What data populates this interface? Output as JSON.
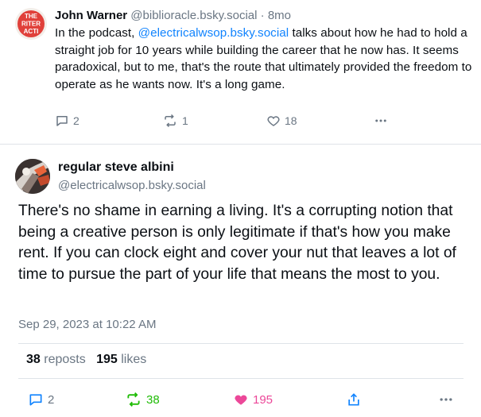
{
  "reply_post": {
    "author_name": "John Warner",
    "author_handle": "@biblioracle.bsky.social",
    "separator": "·",
    "time_ago": "8mo",
    "text_before": "In the podcast, ",
    "mention": "@electricalwsop.bsky.social",
    "text_after": " talks about how he had to hold a straight job for 10 years while building the career that he now has. It seems paradoxical, but to me, that's the route that ultimately provided the freedom to operate as he wants now. It's a long game.",
    "avatar_text": [
      "THE",
      "RITER",
      "ACTI"
    ],
    "replies": "2",
    "reposts": "1",
    "likes": "18"
  },
  "main_post": {
    "author_name": "regular steve albini",
    "author_handle": "@electricalwsop.bsky.social",
    "text": "There's no shame in earning a living. It's a corrupting notion that being a creative person is only legitimate if that's how you make rent. If you can clock eight and cover your nut that leaves a lot of time to pursue the part of your life that means the most to you.",
    "timestamp": "Sep 29, 2023 at 10:22 AM",
    "repost_count": "38",
    "repost_label": "reposts",
    "like_count": "195",
    "like_label": "likes",
    "replies": "2",
    "reposts": "38",
    "likes": "195"
  },
  "icons": {
    "reply": "speech-bubble-icon",
    "repost": "repost-arrows-icon",
    "like": "heart-icon",
    "share": "share-icon",
    "more": "ellipsis-icon"
  },
  "colors": {
    "mention": "#1083fe",
    "muted": "#6a7683",
    "like_active": "#ec4899",
    "repost_active": "#20bc07",
    "avatar_accent": "#e0403a"
  }
}
